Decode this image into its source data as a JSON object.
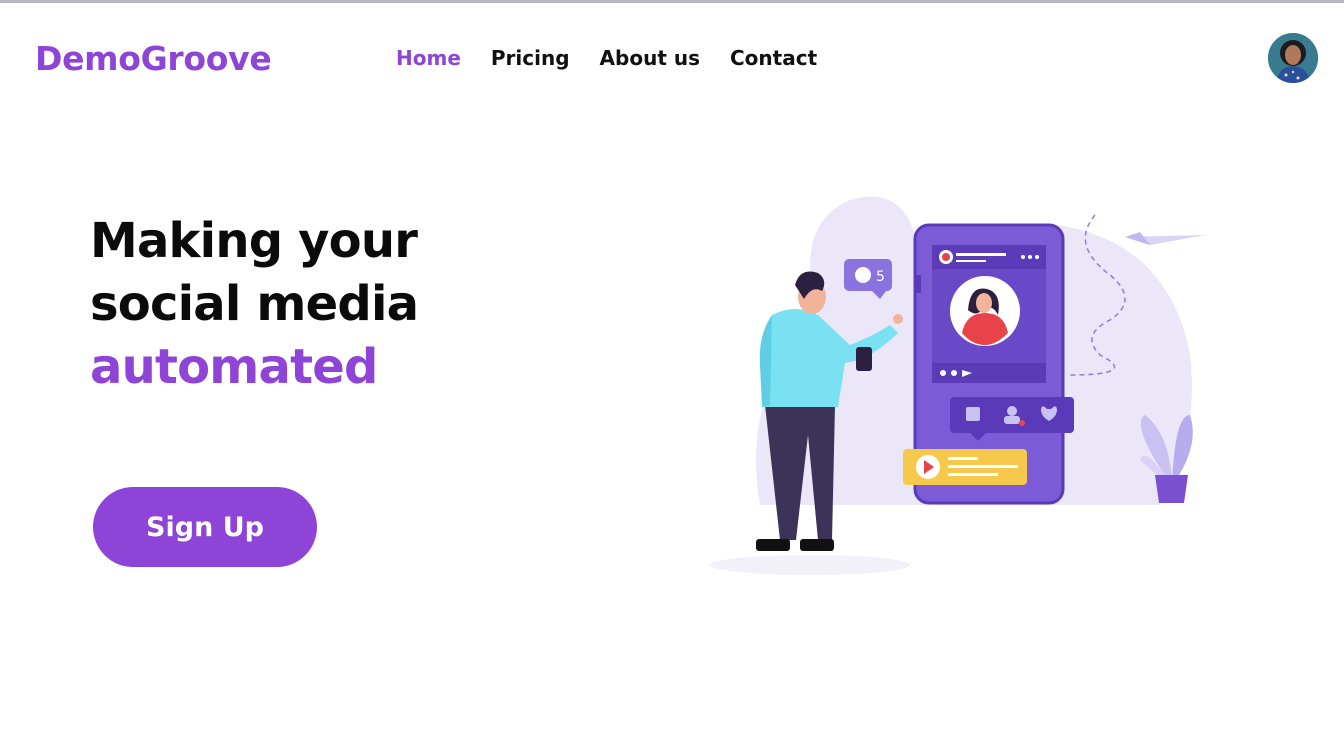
{
  "brand": {
    "name": "DemoGroove",
    "color": "#8e44d6"
  },
  "nav": {
    "items": [
      {
        "label": "Home",
        "active": true
      },
      {
        "label": "Pricing",
        "active": false
      },
      {
        "label": "About us",
        "active": false
      },
      {
        "label": "Contact",
        "active": false
      }
    ]
  },
  "user": {
    "avatar_icon": "user-avatar"
  },
  "hero": {
    "line1": "Making your",
    "line2": "social media",
    "line3": "automated",
    "cta_label": "Sign Up"
  },
  "illustration": {
    "notification_count": "5",
    "icons": [
      "chat-bubble-icon",
      "like-icon",
      "user-icon",
      "heart-icon",
      "play-icon",
      "paper-plane-icon"
    ]
  }
}
